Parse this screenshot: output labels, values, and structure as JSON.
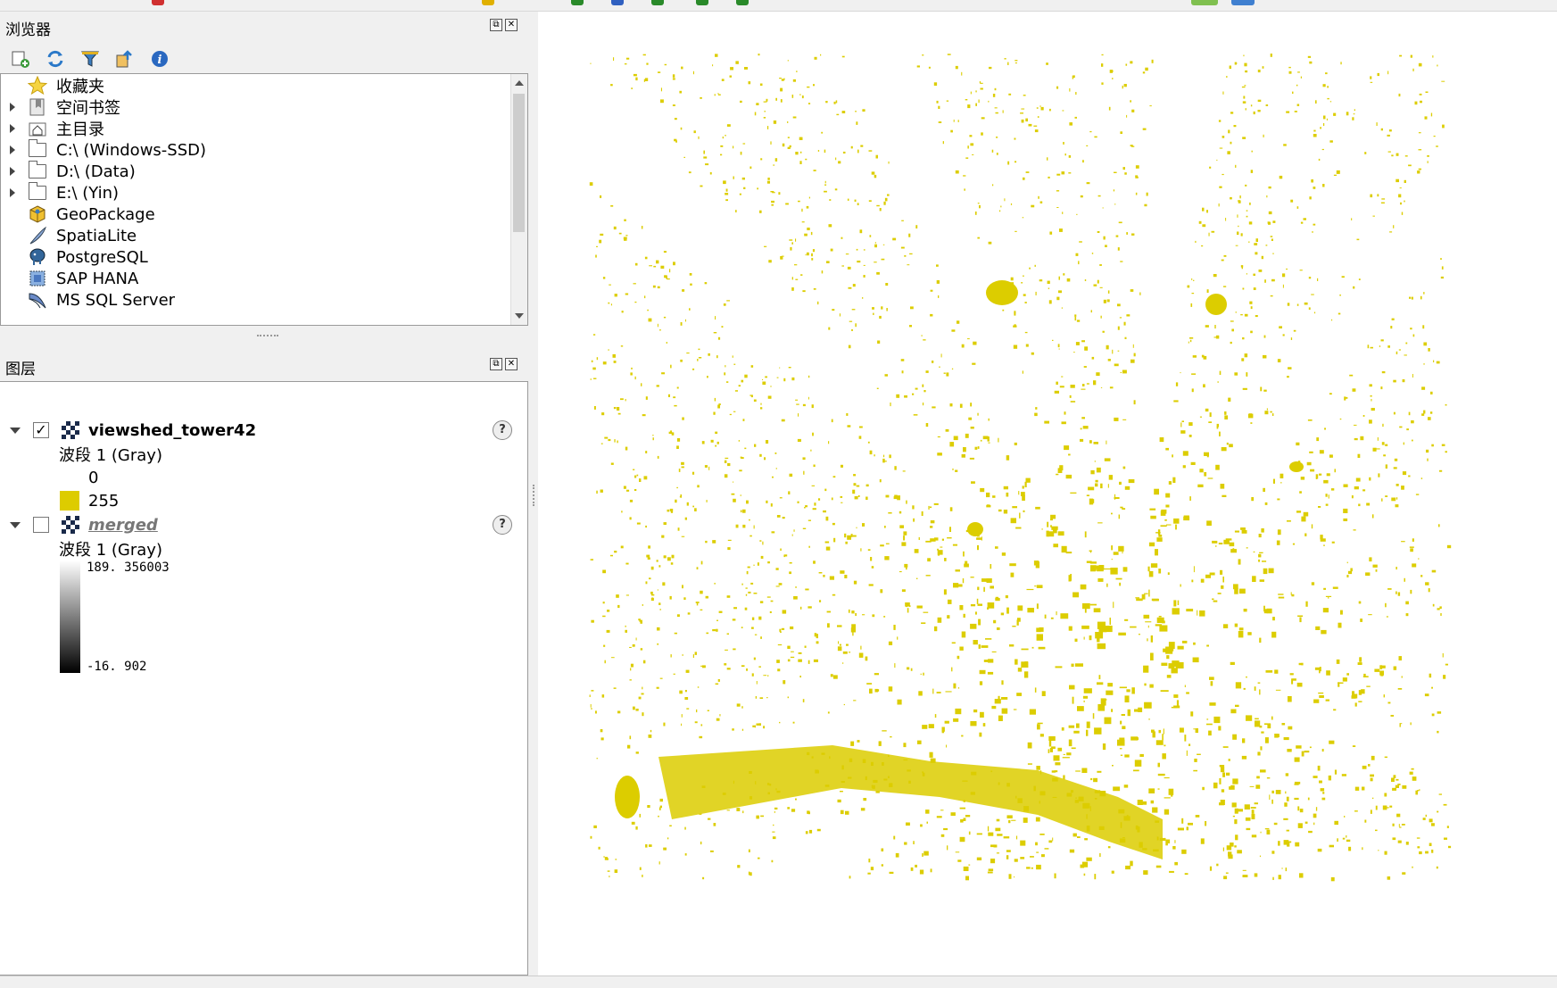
{
  "browser_panel": {
    "title": "浏览器",
    "float_button": "⧉",
    "close_button": "✕",
    "toolbar": [
      {
        "name": "add-selected-layers",
        "icon": "add-layer-icon"
      },
      {
        "name": "refresh",
        "icon": "refresh-icon"
      },
      {
        "name": "filter-browser",
        "icon": "filter-icon"
      },
      {
        "name": "collapse-all",
        "icon": "collapse-icon"
      },
      {
        "name": "enable-properties",
        "icon": "info-icon"
      }
    ],
    "items": [
      {
        "label": "收藏夹",
        "icon": "star-icon",
        "expandable": false
      },
      {
        "label": "空间书签",
        "icon": "bookmark-icon",
        "expandable": true
      },
      {
        "label": "主目录",
        "icon": "home-folder-icon",
        "expandable": true
      },
      {
        "label": "C:\\ (Windows-SSD)",
        "icon": "folder-icon",
        "expandable": true
      },
      {
        "label": "D:\\ (Data)",
        "icon": "folder-icon",
        "expandable": true
      },
      {
        "label": "E:\\ (Yin)",
        "icon": "folder-icon",
        "expandable": true
      },
      {
        "label": "GeoPackage",
        "icon": "geopackage-icon",
        "expandable": false
      },
      {
        "label": "SpatiaLite",
        "icon": "spatialite-icon",
        "expandable": false
      },
      {
        "label": "PostgreSQL",
        "icon": "postgresql-icon",
        "expandable": false
      },
      {
        "label": "SAP HANA",
        "icon": "sap-hana-icon",
        "expandable": false
      },
      {
        "label": "MS SQL Server",
        "icon": "mssql-icon",
        "expandable": false
      }
    ]
  },
  "layers_panel": {
    "title": "图层",
    "float_button": "⧉",
    "close_button": "✕",
    "toolbar": [
      {
        "name": "open-layer-styling",
        "icon": "paint-brush-icon"
      },
      {
        "name": "add-group",
        "icon": "add-group-icon"
      },
      {
        "name": "manage-map-themes",
        "icon": "eye-icon"
      },
      {
        "name": "filter-legend",
        "icon": "filter-icon"
      },
      {
        "name": "filter-by-expression",
        "icon": "expression-icon"
      },
      {
        "name": "expand-all",
        "icon": "expand-all-icon"
      },
      {
        "name": "collapse-all",
        "icon": "collapse-all-icon"
      },
      {
        "name": "remove-layer",
        "icon": "remove-layer-icon"
      }
    ],
    "layers": [
      {
        "name": "viewshed_tower42",
        "checked": true,
        "checkmark": "✓",
        "band": "波段 1 (Gray)",
        "entries": [
          {
            "value": "0",
            "color": "#ffffff"
          },
          {
            "value": "255",
            "color": "#ddcc00"
          }
        ]
      },
      {
        "name": "merged",
        "checked": false,
        "band": "波段 1 (Gray)",
        "ramp_max": "189. 356003",
        "ramp_min": "-16. 902"
      }
    ],
    "help_icon": "?"
  },
  "map": {
    "fill_color": "#dccd00",
    "background": "#ffffff"
  }
}
